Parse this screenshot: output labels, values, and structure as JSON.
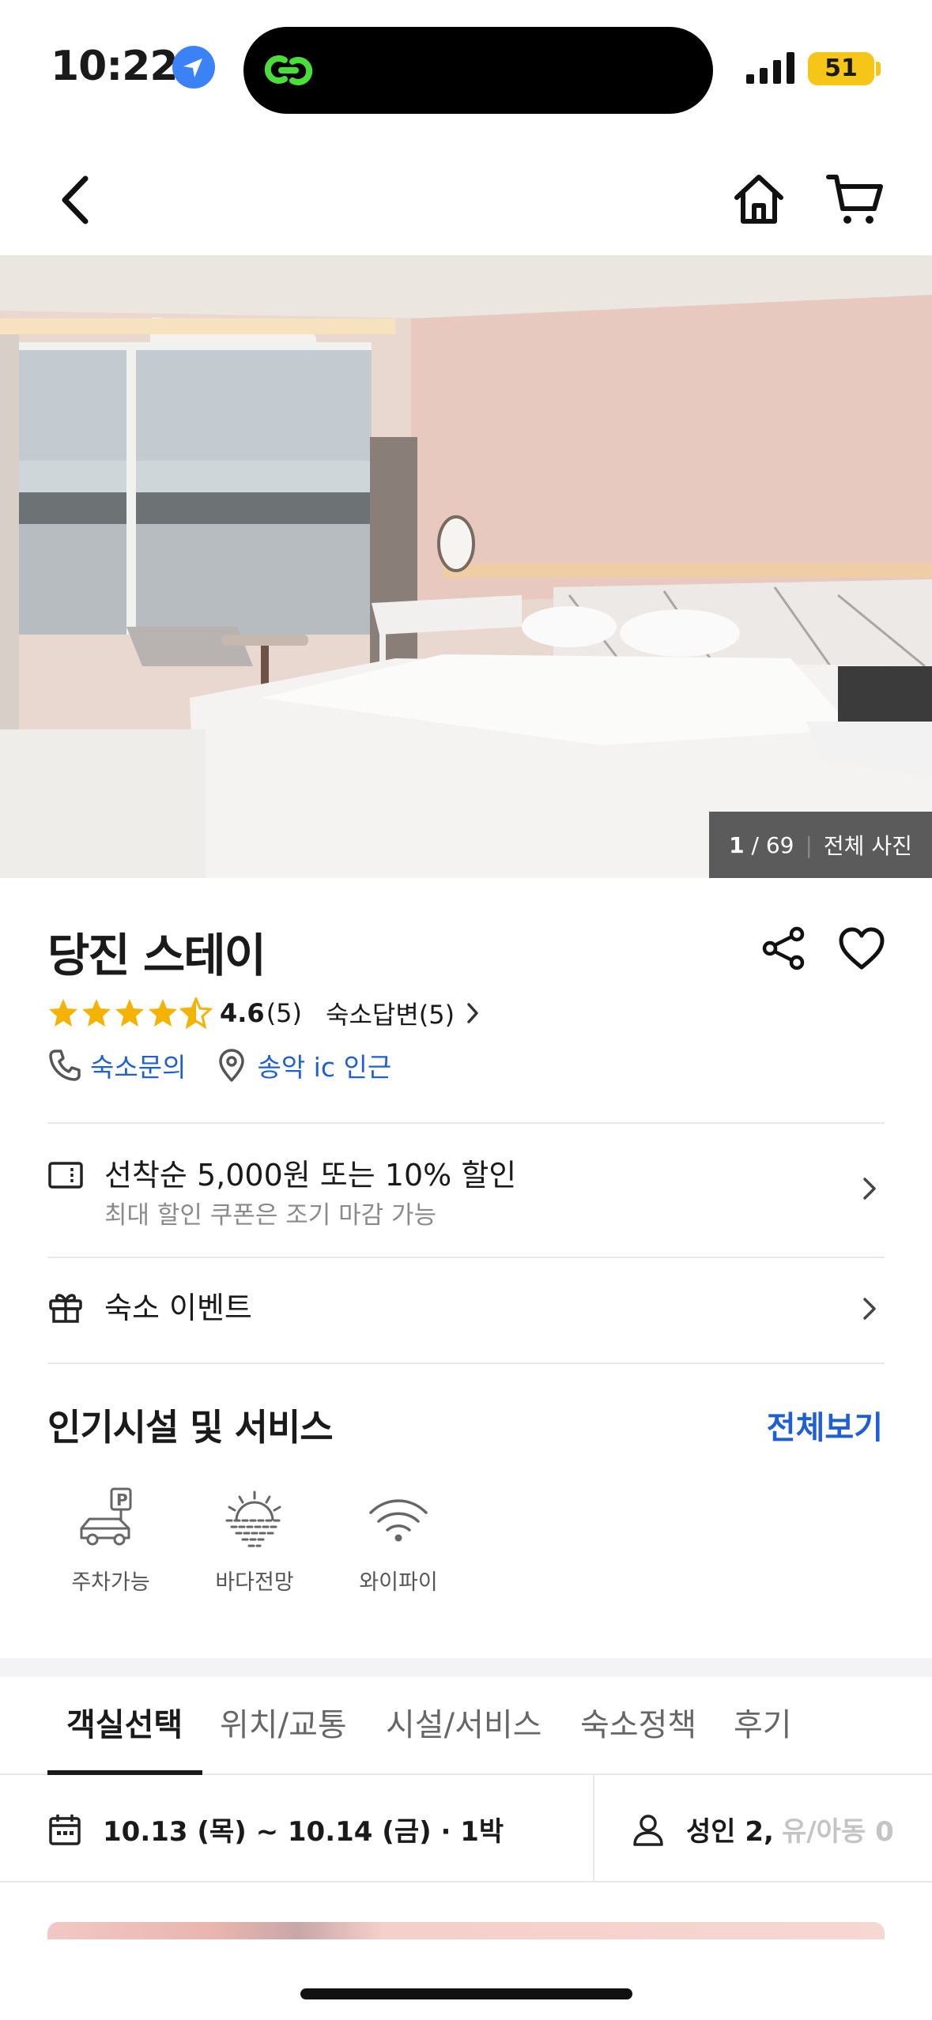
{
  "status_bar": {
    "time": "10:22",
    "battery": "51"
  },
  "hero": {
    "current": "1",
    "total": "/ 69",
    "separator": "|",
    "all_photos": "전체 사진"
  },
  "property": {
    "name": "당진 스테이",
    "rating": "4.6",
    "rating_count": "(5)",
    "stars": 4.5,
    "reply": "숙소답변(5)",
    "contact": "숙소문의",
    "location": "송악 ic 인근"
  },
  "promos": [
    {
      "title": "선착순 5,000원 또는 10% 할인",
      "sub": "최대 할인 쿠폰은 조기 마감 가능"
    },
    {
      "title": "숙소 이벤트"
    }
  ],
  "amenities_section": {
    "title": "인기시설 및 서비스",
    "see_all": "전체보기",
    "items": [
      "주차가능",
      "바다전망",
      "와이파이"
    ]
  },
  "tabs": [
    "객실선택",
    "위치/교통",
    "시설/서비스",
    "숙소정책",
    "후기"
  ],
  "booking": {
    "dates": "10.13 (목) ~ 10.14 (금) · 1박",
    "adults": "성인 2,",
    "children": "유/아동 0"
  },
  "colors": {
    "accent": "#1f5fd6",
    "star": "#f5b301",
    "battery": "#f5c518"
  }
}
